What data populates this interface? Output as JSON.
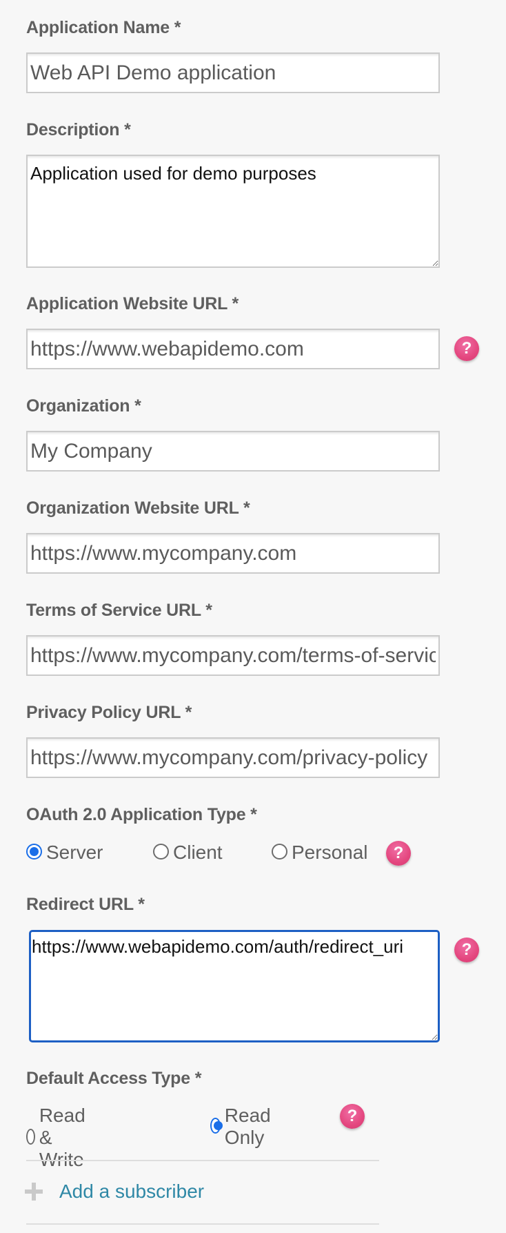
{
  "form": {
    "app_name": {
      "label": "Application Name *",
      "value": "Web API Demo application"
    },
    "description": {
      "label": "Description *",
      "value": "Application used for demo purposes"
    },
    "app_website": {
      "label": "Application Website URL *",
      "value": "https://www.webapidemo.com"
    },
    "organization": {
      "label": "Organization *",
      "value": "My Company"
    },
    "org_website": {
      "label": "Organization Website URL *",
      "value": "https://www.mycompany.com"
    },
    "tos_url": {
      "label": "Terms of Service URL *",
      "value": "https://www.mycompany.com/terms-of-service"
    },
    "privacy_url": {
      "label": "Privacy Policy URL *",
      "value": "https://www.mycompany.com/privacy-policy"
    },
    "oauth_type": {
      "label": "OAuth 2.0 Application Type *",
      "options": [
        "Server",
        "Client",
        "Personal"
      ],
      "selected": "Server"
    },
    "redirect_url": {
      "label": "Redirect URL *",
      "value": "https://www.webapidemo.com/auth/redirect_uri"
    },
    "access_type": {
      "label": "Default Access Type *",
      "options": [
        "Read & Write",
        "Read Only"
      ],
      "selected": "Read Only"
    },
    "add_subscriber": {
      "label": "Add a subscriber"
    },
    "help_glyph": "?"
  },
  "colors": {
    "accent": "#1a6ee8",
    "focus_border": "#1d5fc4",
    "help_icon": "#e4477f",
    "link": "#2f88a6",
    "label": "#5f5f5f"
  }
}
